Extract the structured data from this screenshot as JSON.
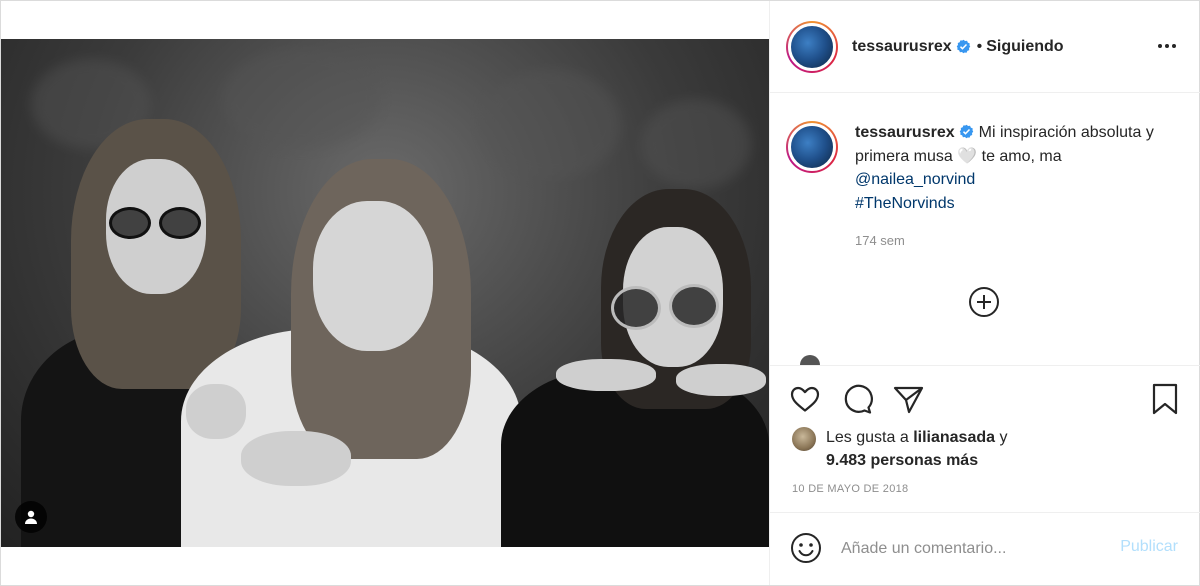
{
  "header": {
    "username": "tessaurusrex",
    "separator": "•",
    "follow_status": "Siguiendo"
  },
  "caption": {
    "username": "tessaurusrex",
    "text": "Mi inspiración absoluta y primera musa 🤍 te amo, ma",
    "mention": "@nailea_norvind",
    "hashtag": "#TheNorvinds",
    "time_ago": "174 sem"
  },
  "likes": {
    "prefix": "Les gusta a",
    "liked_by": "lilianasada",
    "connector": "y",
    "count_text": "9.483 personas más"
  },
  "post_date": "10 DE MAYO DE 2018",
  "comment": {
    "placeholder": "Añade un comentario...",
    "publish_label": "Publicar"
  },
  "icons": {
    "verified": "verified-badge-icon",
    "more": "more-options-icon",
    "like": "heart-icon",
    "comment": "comment-icon",
    "share": "paper-plane-icon",
    "save": "bookmark-icon",
    "load_more": "plus-circle-icon",
    "emoji": "emoji-icon",
    "tag": "user-tag-icon"
  },
  "colors": {
    "verified_blue": "#3897f0",
    "link_blue": "#00376b",
    "publish_disabled": "#b2dffc",
    "muted_text": "#8e8e8e"
  }
}
